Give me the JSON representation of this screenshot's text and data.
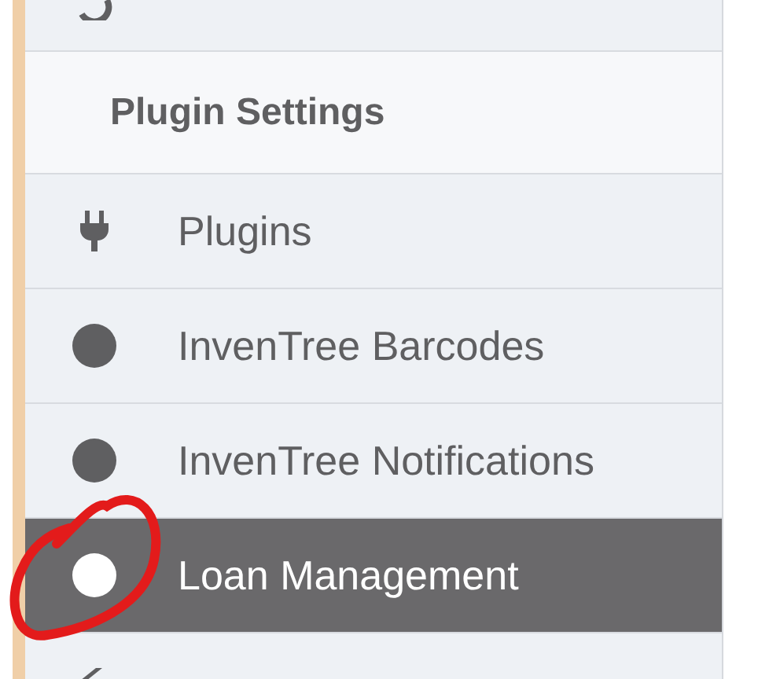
{
  "menu": {
    "items": [
      {
        "kind": "return",
        "selected": false
      },
      {
        "kind": "heading",
        "label": "Plugin Settings"
      },
      {
        "kind": "plug",
        "label": "Plugins",
        "selected": false
      },
      {
        "kind": "dot",
        "label": "InvenTree Barcodes",
        "selected": false
      },
      {
        "kind": "dot",
        "label": "InvenTree Notifications",
        "selected": false
      },
      {
        "kind": "dot",
        "label": "Loan Management",
        "selected": true
      },
      {
        "kind": "edit",
        "selected": false
      }
    ]
  },
  "annotation": {
    "kind": "circle"
  }
}
